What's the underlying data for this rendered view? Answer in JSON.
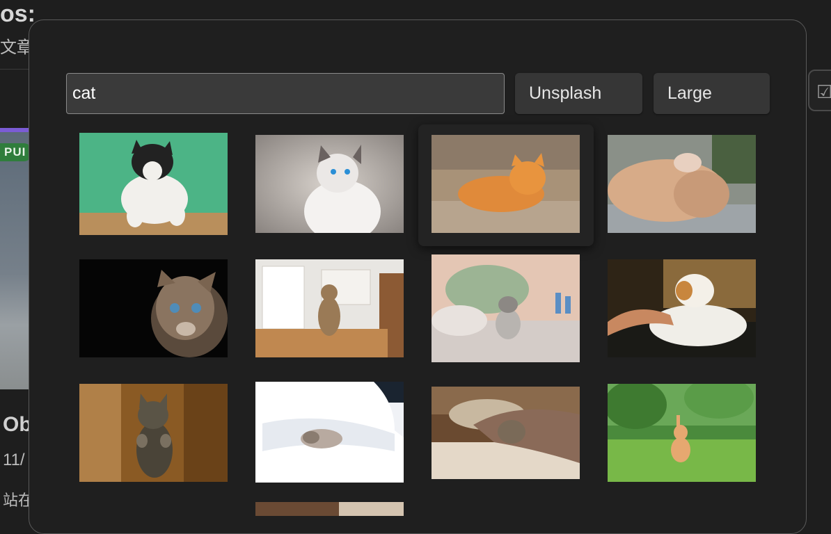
{
  "background": {
    "heading": "os:",
    "subtitle": "文章集",
    "badge": "PUI",
    "post_title": "Ob",
    "post_date": "11/",
    "post_site": "站在"
  },
  "modal": {
    "search": {
      "value": "cat",
      "placeholder": ""
    },
    "source_select": {
      "selected": "Unsplash"
    },
    "size_select": {
      "selected": "Large"
    },
    "results": [
      {
        "name": "black-white-cat-green-wall",
        "hovered": false
      },
      {
        "name": "siamese-blue-eyes-cat",
        "hovered": false
      },
      {
        "name": "orange-cat-lying-floor",
        "hovered": true
      },
      {
        "name": "fluffy-cat-rolling",
        "hovered": false
      },
      {
        "name": "tabby-cat-black-background",
        "hovered": false
      },
      {
        "name": "cat-sitting-kitchen-table",
        "hovered": false
      },
      {
        "name": "kitten-on-bed",
        "hovered": false
      },
      {
        "name": "cat-being-petted",
        "hovered": false
      },
      {
        "name": "cat-standing-wooden-floor",
        "hovered": false
      },
      {
        "name": "cat-under-white-blanket",
        "hovered": false
      },
      {
        "name": "cat-under-pillow-blanket",
        "hovered": false
      },
      {
        "name": "kitten-in-grass",
        "hovered": false
      },
      {
        "name": "partial-thumbnail",
        "hovered": false
      }
    ]
  },
  "colors": {
    "modal_bg": "#1f1f1f",
    "input_bg": "#3a3a3a",
    "button_bg": "#363636",
    "accent_purple": "#7b5cd6",
    "badge_green": "#2f7d3c"
  }
}
